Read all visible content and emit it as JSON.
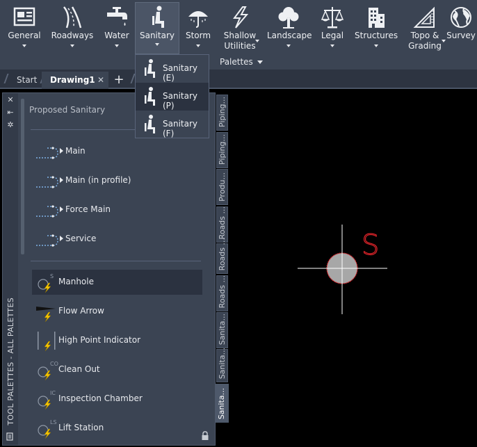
{
  "ribbon": {
    "buttons": [
      {
        "label": "General",
        "icon": "general-icon",
        "dropdown": true
      },
      {
        "label": "Roadways",
        "icon": "roadways-icon",
        "dropdown": true
      },
      {
        "label": "Water",
        "icon": "water-faucet-icon",
        "dropdown": true
      },
      {
        "label": "Sanitary",
        "icon": "sanitary-icon",
        "dropdown": true,
        "active": true
      },
      {
        "label": "Storm",
        "icon": "storm-umbrella-icon",
        "dropdown": true
      },
      {
        "label": "Shallow\nUtilities",
        "icon": "lightning-icon",
        "dropdown": true
      },
      {
        "label": "Landscape",
        "icon": "tree-icon",
        "dropdown": true
      },
      {
        "label": "Legal",
        "icon": "scales-icon",
        "dropdown": true
      },
      {
        "label": "Structures",
        "icon": "building-icon",
        "dropdown": true
      },
      {
        "label": "Topo &\nGrading",
        "icon": "triangle-ruler-icon",
        "dropdown": true
      },
      {
        "label": "Survey",
        "icon": "globe-icon",
        "dropdown": false
      }
    ],
    "palettes_label": "Palettes"
  },
  "tabs": {
    "start": "Start",
    "drawing": "Drawing1",
    "close": "✕",
    "add": "+"
  },
  "flyout": {
    "items": [
      {
        "label": "Sanitary (E)",
        "selected": false
      },
      {
        "label": "Sanitary (P)",
        "selected": true
      },
      {
        "label": "Sanitary (F)",
        "selected": false
      }
    ]
  },
  "palette": {
    "vertical_title": "TOOL PALETTES - ALL PALETTES",
    "section_title": "Proposed Sanitary",
    "group_items": [
      {
        "label": "Main"
      },
      {
        "label": "Main (in profile)"
      },
      {
        "label": "Force Main"
      },
      {
        "label": "Service"
      }
    ],
    "tool_items": [
      {
        "label": "Manhole",
        "highlighted": true,
        "glyph": "S"
      },
      {
        "label": "Flow Arrow",
        "highlighted": false,
        "glyph": ""
      },
      {
        "label": "High Point Indicator",
        "highlighted": false,
        "glyph": ""
      },
      {
        "label": "Clean Out",
        "highlighted": false,
        "glyph": "CO"
      },
      {
        "label": "Inspection Chamber",
        "highlighted": false,
        "glyph": "IC"
      },
      {
        "label": "Lift Station",
        "highlighted": false,
        "glyph": "LS"
      }
    ]
  },
  "side_tabs": [
    {
      "label": "Piping...",
      "active": false
    },
    {
      "label": "Piping...",
      "active": false
    },
    {
      "label": "Produ...",
      "active": false
    },
    {
      "label": "Roads ...",
      "active": false
    },
    {
      "label": "Roads ...",
      "active": false
    },
    {
      "label": "Roads ...",
      "active": false
    },
    {
      "label": "Sanita...",
      "active": false
    },
    {
      "label": "Sanita...",
      "active": false
    },
    {
      "label": "Sanita...",
      "active": true
    }
  ],
  "canvas": {
    "symbol_letter": "S",
    "symbol_color": "#e0242a",
    "fill_color": "#a7a7a7",
    "crosshair_color": "#ffffff"
  },
  "colors": {
    "ribbon_bg": "#3b4453",
    "palette_bg": "#3b4453",
    "canvas_bg": "#000000",
    "bolt": "#f5c400"
  }
}
